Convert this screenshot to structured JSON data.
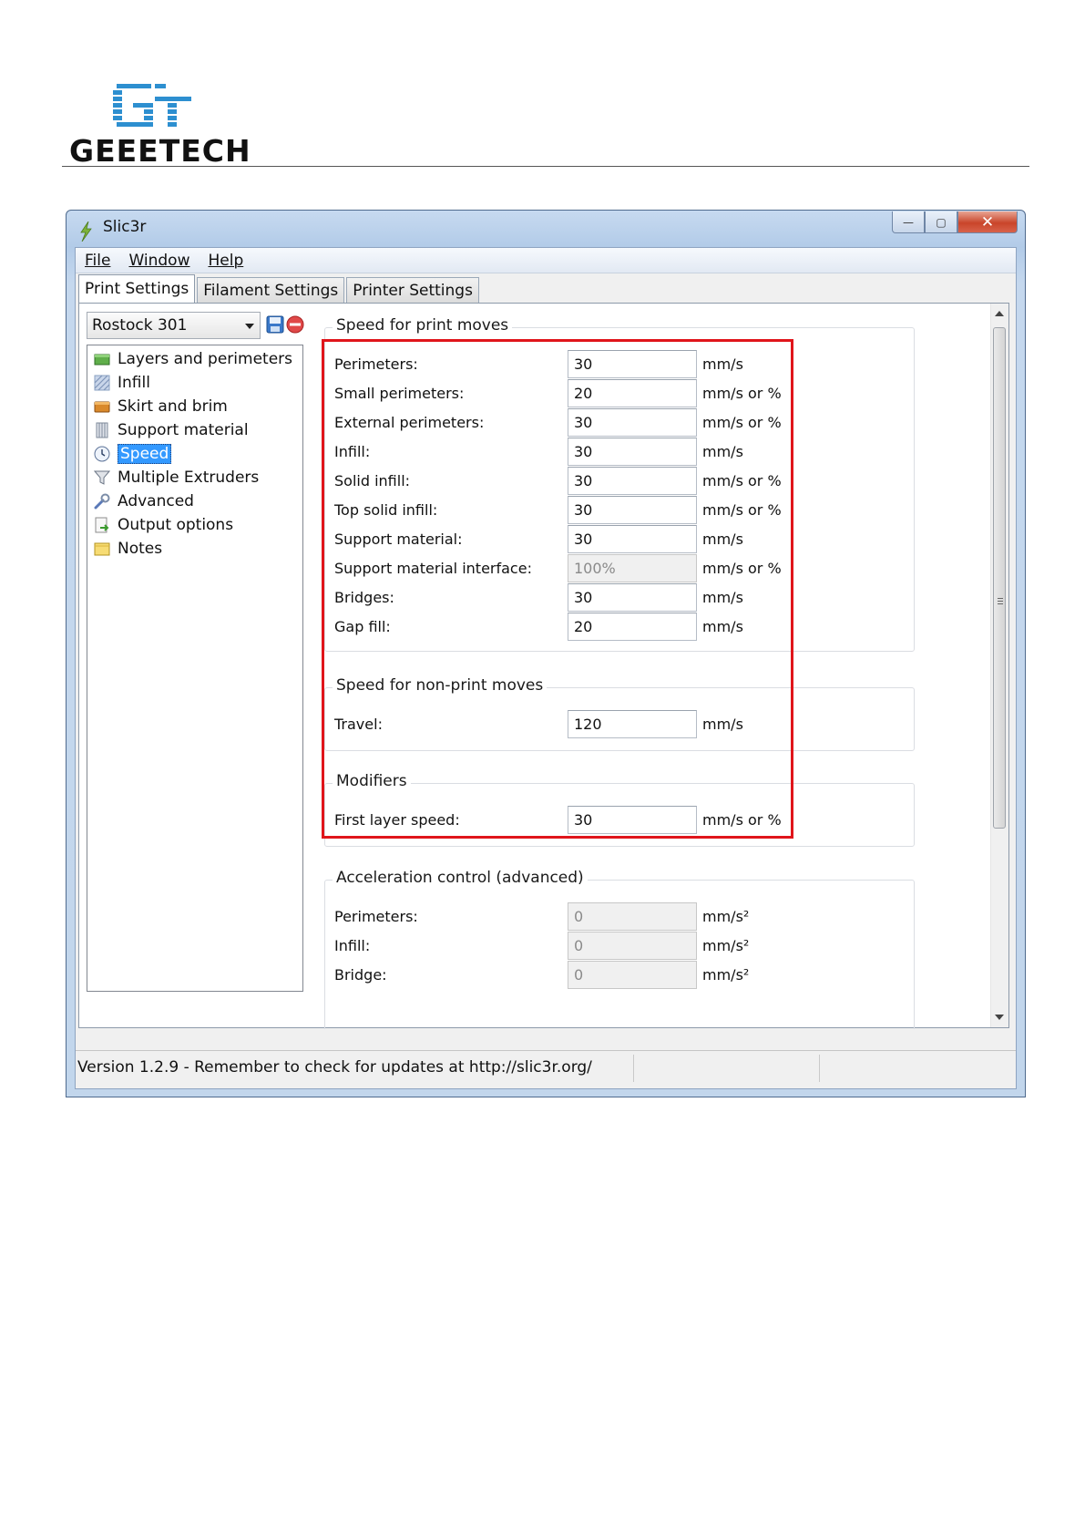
{
  "logo": {
    "text": "GEEETECH"
  },
  "window": {
    "title": "Slic3r",
    "controls": {
      "minimize": "—",
      "maximize": "▢",
      "close": "✕"
    }
  },
  "menu": [
    "File",
    "Window",
    "Help"
  ],
  "tabs": [
    "Print Settings",
    "Filament Settings",
    "Printer Settings"
  ],
  "preset": {
    "value": "Rostock 301"
  },
  "pages": [
    {
      "label": "Layers and perimeters",
      "icon": "layers-icon"
    },
    {
      "label": "Infill",
      "icon": "infill-icon"
    },
    {
      "label": "Skirt and brim",
      "icon": "skirt-icon"
    },
    {
      "label": "Support material",
      "icon": "support-icon"
    },
    {
      "label": "Speed",
      "icon": "clock-icon",
      "selected": true
    },
    {
      "label": "Multiple Extruders",
      "icon": "funnel-icon"
    },
    {
      "label": "Advanced",
      "icon": "wrench-icon"
    },
    {
      "label": "Output options",
      "icon": "output-icon"
    },
    {
      "label": "Notes",
      "icon": "note-icon"
    }
  ],
  "groups": {
    "print_moves": {
      "title": "Speed for print moves",
      "rows": [
        {
          "label": "Perimeters:",
          "value": "30",
          "unit": "mm/s"
        },
        {
          "label": "Small perimeters:",
          "value": "20",
          "unit": "mm/s or %"
        },
        {
          "label": "External perimeters:",
          "value": "30",
          "unit": "mm/s or %"
        },
        {
          "label": "Infill:",
          "value": "30",
          "unit": "mm/s"
        },
        {
          "label": "Solid infill:",
          "value": "30",
          "unit": "mm/s or %"
        },
        {
          "label": "Top solid infill:",
          "value": "30",
          "unit": "mm/s or %"
        },
        {
          "label": "Support material:",
          "value": "30",
          "unit": "mm/s"
        },
        {
          "label": "Support material interface:",
          "value": "100%",
          "unit": "mm/s or %",
          "disabled": true
        },
        {
          "label": "Bridges:",
          "value": "30",
          "unit": "mm/s"
        },
        {
          "label": "Gap fill:",
          "value": "20",
          "unit": "mm/s"
        }
      ]
    },
    "non_print_moves": {
      "title": "Speed for non-print moves",
      "rows": [
        {
          "label": "Travel:",
          "value": "120",
          "unit": "mm/s"
        }
      ]
    },
    "modifiers": {
      "title": "Modifiers",
      "rows": [
        {
          "label": "First layer speed:",
          "value": "30",
          "unit": "mm/s or %"
        }
      ]
    },
    "acceleration": {
      "title": "Acceleration control (advanced)",
      "rows": [
        {
          "label": "Perimeters:",
          "value": "0",
          "unit": "mm/s²",
          "disabled": true
        },
        {
          "label": "Infill:",
          "value": "0",
          "unit": "mm/s²",
          "disabled": true
        },
        {
          "label": "Bridge:",
          "value": "0",
          "unit": "mm/s²",
          "disabled": true
        }
      ]
    }
  },
  "status": {
    "text": "Version 1.2.9 - Remember to check for updates at http://slic3r.org/"
  },
  "colors": {
    "highlight": "#e0151b",
    "selection": "#3399ff",
    "logo_blue": "#2d8fd0"
  }
}
